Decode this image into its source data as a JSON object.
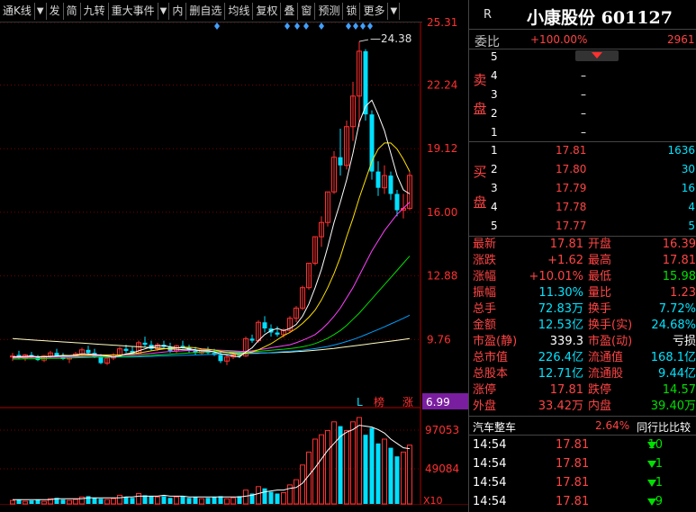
{
  "toolbar": {
    "items": [
      "通K线",
      "发",
      "简",
      "九转",
      "重大事件",
      "内",
      "删自选",
      "均线",
      "复权",
      "叠",
      "窗",
      "预测",
      "锁",
      "更多"
    ],
    "dropdown_marker": "▼",
    "right_marker": "▼"
  },
  "chart_data": {
    "type": "candlestick",
    "title": "",
    "price_axis_labels": [
      "25.31",
      "22.24",
      "19.12",
      "16.00",
      "12.88",
      "9.76",
      "6.99"
    ],
    "volume_axis_labels": [
      "97053",
      "49084"
    ],
    "volume_unit_label": "X10",
    "high_annotation": "24.38",
    "ylim": [
      6.99,
      25.31
    ],
    "current_price_box": "6.99",
    "badges": [
      "L",
      "榜",
      "涨"
    ],
    "colors": {
      "up": "#ff3030",
      "down": "#00e0ff",
      "ma5": "#ffffff",
      "ma10": "#ffe000",
      "ma20": "#ff40ff",
      "ma30": "#00e000",
      "ma60": "#00a0ff",
      "ma120": "#ffffc0"
    },
    "candles": [
      {
        "o": 8.9,
        "h": 9.1,
        "l": 8.7,
        "c": 8.95
      },
      {
        "o": 9.0,
        "h": 9.2,
        "l": 8.8,
        "c": 8.85
      },
      {
        "o": 8.85,
        "h": 9.05,
        "l": 8.7,
        "c": 9.0
      },
      {
        "o": 9.0,
        "h": 9.15,
        "l": 8.85,
        "c": 8.9
      },
      {
        "o": 8.9,
        "h": 9.0,
        "l": 8.7,
        "c": 8.75
      },
      {
        "o": 8.75,
        "h": 9.0,
        "l": 8.65,
        "c": 8.95
      },
      {
        "o": 8.95,
        "h": 9.2,
        "l": 8.85,
        "c": 9.1
      },
      {
        "o": 9.1,
        "h": 9.3,
        "l": 8.9,
        "c": 8.95
      },
      {
        "o": 8.95,
        "h": 9.1,
        "l": 8.75,
        "c": 8.8
      },
      {
        "o": 8.8,
        "h": 9.0,
        "l": 8.6,
        "c": 8.95
      },
      {
        "o": 8.95,
        "h": 9.15,
        "l": 8.85,
        "c": 9.05
      },
      {
        "o": 9.05,
        "h": 9.35,
        "l": 8.95,
        "c": 9.25
      },
      {
        "o": 9.25,
        "h": 9.45,
        "l": 9.0,
        "c": 9.1
      },
      {
        "o": 9.1,
        "h": 9.3,
        "l": 8.85,
        "c": 8.9
      },
      {
        "o": 8.9,
        "h": 9.05,
        "l": 8.55,
        "c": 8.6
      },
      {
        "o": 8.6,
        "h": 8.9,
        "l": 8.5,
        "c": 8.85
      },
      {
        "o": 8.85,
        "h": 9.1,
        "l": 8.75,
        "c": 9.0
      },
      {
        "o": 9.0,
        "h": 9.4,
        "l": 8.9,
        "c": 9.3
      },
      {
        "o": 9.3,
        "h": 9.5,
        "l": 9.1,
        "c": 9.2
      },
      {
        "o": 9.2,
        "h": 9.4,
        "l": 9.0,
        "c": 9.05
      },
      {
        "o": 9.05,
        "h": 9.7,
        "l": 9.0,
        "c": 9.6
      },
      {
        "o": 9.6,
        "h": 9.9,
        "l": 9.4,
        "c": 9.5
      },
      {
        "o": 9.5,
        "h": 9.7,
        "l": 9.2,
        "c": 9.3
      },
      {
        "o": 9.3,
        "h": 9.6,
        "l": 9.2,
        "c": 9.5
      },
      {
        "o": 9.5,
        "h": 9.7,
        "l": 9.3,
        "c": 9.4
      },
      {
        "o": 9.4,
        "h": 9.6,
        "l": 9.1,
        "c": 9.2
      },
      {
        "o": 9.2,
        "h": 9.5,
        "l": 9.1,
        "c": 9.45
      },
      {
        "o": 9.45,
        "h": 9.7,
        "l": 9.3,
        "c": 9.35
      },
      {
        "o": 9.35,
        "h": 9.5,
        "l": 9.1,
        "c": 9.2
      },
      {
        "o": 9.2,
        "h": 9.4,
        "l": 9.0,
        "c": 9.1
      },
      {
        "o": 9.1,
        "h": 9.3,
        "l": 9.0,
        "c": 9.25
      },
      {
        "o": 9.25,
        "h": 9.4,
        "l": 9.05,
        "c": 9.1
      },
      {
        "o": 9.1,
        "h": 9.3,
        "l": 8.95,
        "c": 9.0
      },
      {
        "o": 9.0,
        "h": 9.2,
        "l": 8.6,
        "c": 8.7
      },
      {
        "o": 8.7,
        "h": 9.0,
        "l": 8.5,
        "c": 8.9
      },
      {
        "o": 8.9,
        "h": 9.1,
        "l": 8.8,
        "c": 9.0
      },
      {
        "o": 9.0,
        "h": 9.2,
        "l": 8.85,
        "c": 8.95
      },
      {
        "o": 8.95,
        "h": 9.9,
        "l": 8.9,
        "c": 9.8
      },
      {
        "o": 9.8,
        "h": 10.0,
        "l": 9.6,
        "c": 9.7
      },
      {
        "o": 9.7,
        "h": 10.7,
        "l": 9.6,
        "c": 10.6
      },
      {
        "o": 10.6,
        "h": 10.9,
        "l": 10.1,
        "c": 10.3
      },
      {
        "o": 10.3,
        "h": 10.5,
        "l": 9.9,
        "c": 10.1
      },
      {
        "o": 10.1,
        "h": 10.4,
        "l": 9.9,
        "c": 10.0
      },
      {
        "o": 10.0,
        "h": 10.3,
        "l": 9.85,
        "c": 10.2
      },
      {
        "o": 10.2,
        "h": 10.9,
        "l": 10.1,
        "c": 10.8
      },
      {
        "o": 10.8,
        "h": 11.4,
        "l": 10.6,
        "c": 11.3
      },
      {
        "o": 11.3,
        "h": 12.4,
        "l": 11.2,
        "c": 12.3
      },
      {
        "o": 12.3,
        "h": 13.5,
        "l": 12.2,
        "c": 13.5
      },
      {
        "o": 13.5,
        "h": 14.8,
        "l": 13.4,
        "c": 14.8
      },
      {
        "o": 14.8,
        "h": 15.8,
        "l": 14.3,
        "c": 15.5
      },
      {
        "o": 15.5,
        "h": 17.0,
        "l": 15.3,
        "c": 17.0
      },
      {
        "o": 17.0,
        "h": 19.0,
        "l": 16.9,
        "c": 18.7
      },
      {
        "o": 18.7,
        "h": 20.1,
        "l": 17.8,
        "c": 18.3
      },
      {
        "o": 18.3,
        "h": 20.5,
        "l": 18.1,
        "c": 20.2
      },
      {
        "o": 20.2,
        "h": 22.4,
        "l": 19.5,
        "c": 21.7
      },
      {
        "o": 21.7,
        "h": 24.38,
        "l": 20.2,
        "c": 23.9
      },
      {
        "o": 23.9,
        "h": 24.0,
        "l": 20.5,
        "c": 20.8
      },
      {
        "o": 20.8,
        "h": 21.0,
        "l": 17.6,
        "c": 18.0
      },
      {
        "o": 18.0,
        "h": 18.5,
        "l": 16.8,
        "c": 17.2
      },
      {
        "o": 17.2,
        "h": 18.3,
        "l": 16.9,
        "c": 17.8
      },
      {
        "o": 17.8,
        "h": 18.0,
        "l": 16.6,
        "c": 16.9
      },
      {
        "o": 16.9,
        "h": 17.1,
        "l": 15.8,
        "c": 16.1
      },
      {
        "o": 16.1,
        "h": 16.9,
        "l": 15.7,
        "c": 16.19
      },
      {
        "o": 16.19,
        "h": 18.0,
        "l": 16.1,
        "c": 17.81
      }
    ],
    "volumes": [
      4,
      5,
      3,
      4,
      5,
      3,
      6,
      7,
      5,
      4,
      5,
      8,
      9,
      7,
      6,
      5,
      6,
      10,
      8,
      7,
      12,
      10,
      9,
      8,
      9,
      7,
      8,
      9,
      7,
      8,
      6,
      7,
      8,
      9,
      6,
      7,
      9,
      16,
      12,
      20,
      18,
      14,
      12,
      13,
      22,
      28,
      45,
      60,
      75,
      80,
      85,
      95,
      90,
      85,
      95,
      100,
      80,
      88,
      70,
      75,
      65,
      55,
      60,
      68
    ],
    "volume_ma5": [
      5,
      5,
      5,
      5,
      5,
      5,
      5,
      6,
      6,
      6,
      6,
      6,
      7,
      7,
      7,
      7,
      7,
      7,
      8,
      8,
      9,
      9,
      9,
      9,
      10,
      9,
      9,
      9,
      8,
      8,
      8,
      8,
      8,
      8,
      8,
      8,
      8,
      9,
      10,
      12,
      14,
      15,
      16,
      16,
      18,
      19,
      24,
      33,
      42,
      52,
      62,
      70,
      78,
      83,
      86,
      91,
      90,
      89,
      86,
      82,
      75,
      70,
      65,
      64
    ],
    "ma5": [
      8.9,
      8.92,
      8.93,
      8.95,
      8.9,
      8.9,
      8.92,
      8.95,
      8.98,
      8.97,
      9.0,
      9.05,
      9.05,
      9.02,
      8.98,
      8.95,
      8.9,
      8.95,
      9.05,
      9.1,
      9.2,
      9.3,
      9.4,
      9.45,
      9.45,
      9.4,
      9.35,
      9.35,
      9.3,
      9.25,
      9.2,
      9.2,
      9.15,
      9.05,
      9.0,
      8.95,
      8.9,
      9.15,
      9.35,
      9.7,
      10.0,
      10.2,
      10.3,
      10.2,
      10.3,
      10.5,
      10.9,
      11.5,
      12.3,
      13.2,
      14.3,
      15.5,
      16.5,
      17.6,
      18.9,
      20.4,
      21.2,
      21.5,
      20.8,
      20.0,
      18.9,
      17.8,
      17.1,
      16.9
    ],
    "ma10": [
      8.9,
      8.9,
      8.91,
      8.92,
      8.92,
      8.92,
      8.93,
      8.94,
      8.95,
      8.96,
      8.97,
      8.99,
      9.0,
      9.01,
      9.0,
      9.0,
      9.0,
      9.0,
      9.03,
      9.05,
      9.1,
      9.15,
      9.2,
      9.25,
      9.3,
      9.33,
      9.35,
      9.37,
      9.38,
      9.35,
      9.3,
      9.28,
      9.24,
      9.18,
      9.12,
      9.06,
      9.0,
      9.08,
      9.15,
      9.25,
      9.4,
      9.55,
      9.75,
      9.95,
      10.1,
      10.3,
      10.55,
      10.85,
      11.2,
      11.7,
      12.3,
      13.0,
      13.8,
      14.8,
      15.7,
      16.7,
      17.6,
      18.5,
      19.1,
      19.4,
      19.4,
      19.1,
      18.6,
      18.0
    ],
    "ma20": [
      8.85,
      8.86,
      8.87,
      8.88,
      8.89,
      8.9,
      8.9,
      8.9,
      8.91,
      8.92,
      8.92,
      8.93,
      8.94,
      8.95,
      8.96,
      8.97,
      8.98,
      8.99,
      9.0,
      9.01,
      9.03,
      9.05,
      9.08,
      9.11,
      9.14,
      9.17,
      9.19,
      9.2,
      9.22,
      9.23,
      9.24,
      9.24,
      9.24,
      9.23,
      9.22,
      9.2,
      9.18,
      9.17,
      9.2,
      9.25,
      9.3,
      9.35,
      9.4,
      9.45,
      9.5,
      9.6,
      9.72,
      9.85,
      10.0,
      10.25,
      10.55,
      10.9,
      11.3,
      11.8,
      12.3,
      12.9,
      13.5,
      14.1,
      14.6,
      15.1,
      15.5,
      15.9,
      16.2,
      16.5
    ],
    "ma30": [
      8.8,
      8.8,
      8.81,
      8.81,
      8.82,
      8.82,
      8.83,
      8.83,
      8.84,
      8.85,
      8.86,
      8.87,
      8.88,
      8.89,
      8.9,
      8.9,
      8.91,
      8.92,
      8.93,
      8.94,
      8.95,
      8.97,
      8.98,
      9.0,
      9.02,
      9.04,
      9.06,
      9.08,
      9.1,
      9.12,
      9.14,
      9.15,
      9.16,
      9.16,
      9.16,
      9.16,
      9.15,
      9.15,
      9.16,
      9.18,
      9.2,
      9.23,
      9.26,
      9.28,
      9.31,
      9.35,
      9.4,
      9.47,
      9.56,
      9.68,
      9.82,
      10.0,
      10.2,
      10.45,
      10.75,
      11.05,
      11.4,
      11.75,
      12.1,
      12.45,
      12.8,
      13.15,
      13.5,
      13.85
    ],
    "ma60": [
      8.9,
      8.9,
      8.9,
      8.9,
      8.9,
      8.9,
      8.9,
      8.9,
      8.9,
      8.9,
      8.9,
      8.9,
      8.9,
      8.9,
      8.9,
      8.9,
      8.9,
      8.9,
      8.9,
      8.9,
      8.91,
      8.92,
      8.93,
      8.94,
      8.95,
      8.96,
      8.97,
      8.98,
      8.99,
      9.0,
      9.01,
      9.02,
      9.03,
      9.04,
      9.05,
      9.05,
      9.05,
      9.06,
      9.07,
      9.08,
      9.1,
      9.12,
      9.14,
      9.16,
      9.18,
      9.2,
      9.23,
      9.27,
      9.31,
      9.36,
      9.42,
      9.49,
      9.57,
      9.66,
      9.76,
      9.87,
      9.99,
      10.12,
      10.25,
      10.38,
      10.52,
      10.66,
      10.8,
      10.95
    ],
    "ma120": [
      9.8,
      9.78,
      9.76,
      9.74,
      9.72,
      9.7,
      9.68,
      9.66,
      9.64,
      9.62,
      9.6,
      9.58,
      9.56,
      9.54,
      9.52,
      9.5,
      9.48,
      9.46,
      9.44,
      9.42,
      9.4,
      9.38,
      9.36,
      9.34,
      9.32,
      9.3,
      9.28,
      9.26,
      9.24,
      9.22,
      9.2,
      9.18,
      9.16,
      9.14,
      9.12,
      9.11,
      9.1,
      9.1,
      9.1,
      9.1,
      9.1,
      9.11,
      9.12,
      9.13,
      9.14,
      9.16,
      9.18,
      9.2,
      9.23,
      9.26,
      9.29,
      9.32,
      9.36,
      9.4,
      9.44,
      9.48,
      9.52,
      9.56,
      9.6,
      9.64,
      9.68,
      9.72,
      9.76,
      9.8
    ]
  },
  "quote": {
    "r_label": "R",
    "title": "小康股份 601127",
    "weibi_label": "委比",
    "weibi_value": "+100.00%",
    "weibi_diff": "2961",
    "sell_label": [
      "卖",
      "盘"
    ],
    "buy_label": [
      "买",
      "盘"
    ],
    "sell": [
      {
        "lvl": "5",
        "price": "",
        "vol": ""
      },
      {
        "lvl": "4",
        "price": "–",
        "vol": ""
      },
      {
        "lvl": "3",
        "price": "–",
        "vol": ""
      },
      {
        "lvl": "2",
        "price": "–",
        "vol": ""
      },
      {
        "lvl": "1",
        "price": "–",
        "vol": ""
      }
    ],
    "buy": [
      {
        "lvl": "1",
        "price": "17.81",
        "vol": "1636"
      },
      {
        "lvl": "2",
        "price": "17.80",
        "vol": "30"
      },
      {
        "lvl": "3",
        "price": "17.79",
        "vol": "16"
      },
      {
        "lvl": "4",
        "price": "17.78",
        "vol": "4"
      },
      {
        "lvl": "5",
        "price": "17.77",
        "vol": "5"
      }
    ],
    "stats": [
      {
        "l1": "最新",
        "v1": "17.81",
        "c1": "red",
        "l2": "开盘",
        "v2": "16.39",
        "c2": "red"
      },
      {
        "l1": "涨跌",
        "v1": "+1.62",
        "c1": "red",
        "l2": "最高",
        "v2": "17.81",
        "c2": "red"
      },
      {
        "l1": "涨幅",
        "v1": "+10.01%",
        "c1": "red",
        "l2": "最低",
        "v2": "15.98",
        "c2": "grn"
      },
      {
        "l1": "振幅",
        "v1": "11.30%",
        "c1": "cyan",
        "l2": "量比",
        "v2": "1.23",
        "c2": "red"
      },
      {
        "l1": "总手",
        "v1": "72.83万",
        "c1": "cyan",
        "l2": "换手",
        "v2": "7.72%",
        "c2": "cyan"
      },
      {
        "l1": "金额",
        "v1": "12.53亿",
        "c1": "cyan",
        "l2": "换手(实)",
        "v2": "24.68%",
        "c2": "cyan"
      },
      {
        "l1": "市盈(静)",
        "v1": "339.3",
        "c1": "wht",
        "l2": "市盈(动)",
        "v2": "亏损",
        "c2": "wht"
      },
      {
        "l1": "总市值",
        "v1": "226.4亿",
        "c1": "cyan",
        "l2": "流通值",
        "v2": "168.1亿",
        "c2": "cyan"
      },
      {
        "l1": "总股本",
        "v1": "12.71亿",
        "c1": "cyan",
        "l2": "流通股",
        "v2": "9.44亿",
        "c2": "cyan"
      },
      {
        "l1": "涨停",
        "v1": "17.81",
        "c1": "red",
        "l2": "跌停",
        "v2": "14.57",
        "c2": "grn"
      },
      {
        "l1": "外盘",
        "v1": "33.42万",
        "c1": "red",
        "l2": "内盘",
        "v2": "39.40万",
        "c2": "grn"
      }
    ],
    "sector_name": "汽车整车",
    "sector_pct": "2.64%",
    "sector_compare": "同行比比较",
    "ticks": [
      {
        "time": "14:54",
        "price": "17.81",
        "vol": "10"
      },
      {
        "time": "14:54",
        "price": "17.81",
        "vol": "1"
      },
      {
        "time": "14:54",
        "price": "17.81",
        "vol": "1"
      },
      {
        "time": "14:54",
        "price": "17.81",
        "vol": "9"
      }
    ]
  }
}
